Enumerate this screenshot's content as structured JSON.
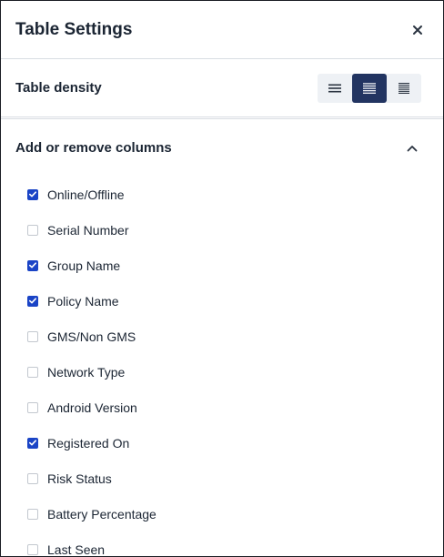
{
  "header": {
    "title": "Table Settings",
    "close_icon": "close-icon"
  },
  "density": {
    "label": "Table density",
    "options": [
      {
        "name": "compact",
        "icon": "density-compact-icon",
        "selected": false
      },
      {
        "name": "default",
        "icon": "density-default-icon",
        "selected": true
      },
      {
        "name": "comfortable",
        "icon": "density-comfortable-icon",
        "selected": false
      }
    ]
  },
  "columns": {
    "title": "Add or remove columns",
    "toggle_icon": "chevron-up-icon",
    "items": [
      {
        "label": "Online/Offline",
        "checked": true
      },
      {
        "label": "Serial Number",
        "checked": false
      },
      {
        "label": "Group Name",
        "checked": true
      },
      {
        "label": "Policy Name",
        "checked": true
      },
      {
        "label": "GMS/Non GMS",
        "checked": false
      },
      {
        "label": "Network Type",
        "checked": false
      },
      {
        "label": "Android Version",
        "checked": false
      },
      {
        "label": "Registered On",
        "checked": true
      },
      {
        "label": "Risk Status",
        "checked": false
      },
      {
        "label": "Battery Percentage",
        "checked": false
      },
      {
        "label": "Last Seen",
        "checked": false
      }
    ]
  },
  "colors": {
    "accent": "#223461",
    "checkbox": "#1a44c6",
    "text": "#1b2533",
    "divider": "#d9dde3"
  }
}
